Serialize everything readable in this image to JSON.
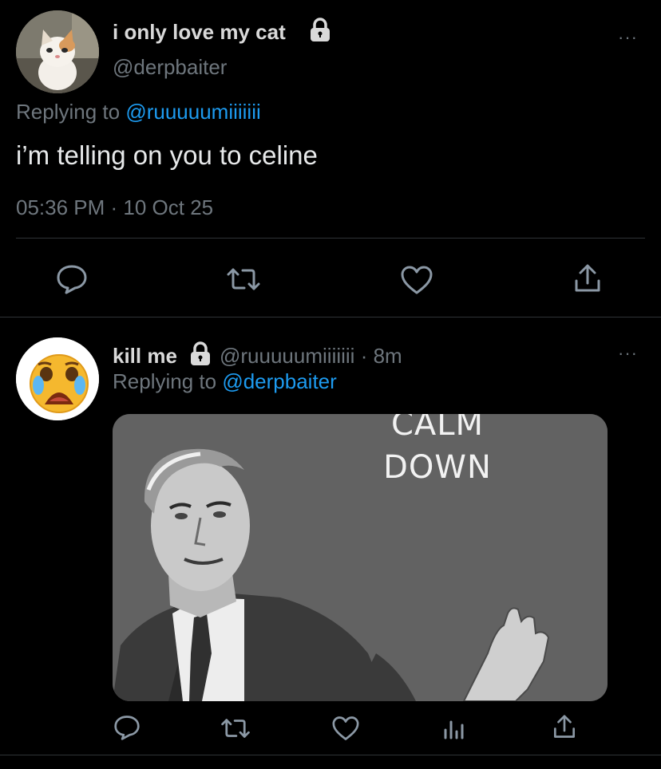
{
  "main_tweet": {
    "display_name": "i only love my cat",
    "handle": "@derpbaiter",
    "replying_prefix": "Replying to",
    "replying_handle": "@ruuuuumiiiiiii",
    "text": "i’m telling on you to celine",
    "timestamp": "05:36 PM · 10 Oct 25",
    "more_label": "···",
    "actions": [
      "reply-icon",
      "retweet-icon",
      "like-icon",
      "share-icon"
    ]
  },
  "reply_tweet": {
    "display_name": "kill me",
    "handle": "@ruuuuumiiiiiii",
    "dot": "·",
    "time": "8m",
    "replying_prefix": "Replying to",
    "replying_handle": "@derpbaiter",
    "more_label": "···",
    "meme_text_line1": "CALM",
    "meme_text_line2": "DOWN",
    "actions": [
      "reply-icon",
      "retweet-icon",
      "like-icon",
      "analytics-icon",
      "share-icon"
    ]
  },
  "colors": {
    "background": "#000000",
    "text": "#d9d9d9",
    "muted": "#6e767d",
    "link": "#1d9bf0",
    "divider": "#2f3336"
  }
}
